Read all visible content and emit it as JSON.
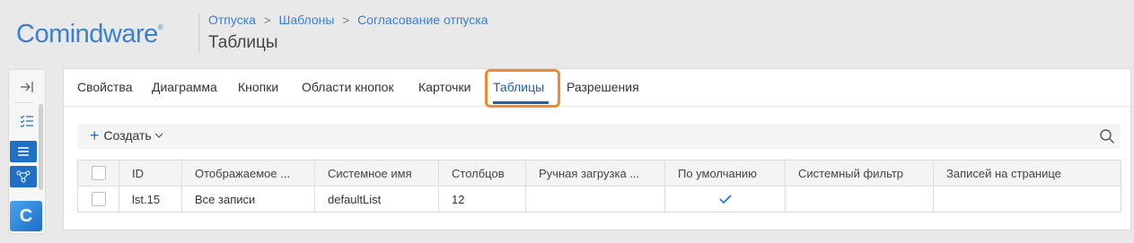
{
  "header": {
    "logo_text": "Comindware",
    "logo_mark": "®",
    "breadcrumbs": [
      "Отпуска",
      "Шаблоны",
      "Согласование отпуска"
    ],
    "breadcrumb_separator": ">",
    "page_title": "Таблицы"
  },
  "rail": {
    "icons": [
      "collapse-icon",
      "checklist-icon",
      "list-icon",
      "diagram-icon",
      "app-logo-icon"
    ],
    "app_logo_letter": "C"
  },
  "tabs": {
    "items": [
      "Свойства",
      "Диаграмма",
      "Кнопки",
      "Области кнопок",
      "Карточки",
      "Таблицы",
      "Разрешения"
    ],
    "active": "Таблицы"
  },
  "toolbar": {
    "create_label": "Создать",
    "search_icon": "search-icon"
  },
  "table": {
    "columns": [
      "ID",
      "Отображаемое ...",
      "Системное имя",
      "Столбцов",
      "Ручная загрузка ...",
      "По умолчанию",
      "Системный фильтр",
      "Записей на странице"
    ],
    "rows": [
      {
        "id": "lst.15",
        "display_name": "Все записи",
        "system_name": "defaultList",
        "columns_count": "12",
        "manual_load": "",
        "is_default": true,
        "system_filter": "",
        "records_per_page": ""
      }
    ]
  },
  "colors": {
    "accent": "#1f6fc7",
    "highlight": "#f08a2c",
    "link": "#3b7fd0"
  }
}
